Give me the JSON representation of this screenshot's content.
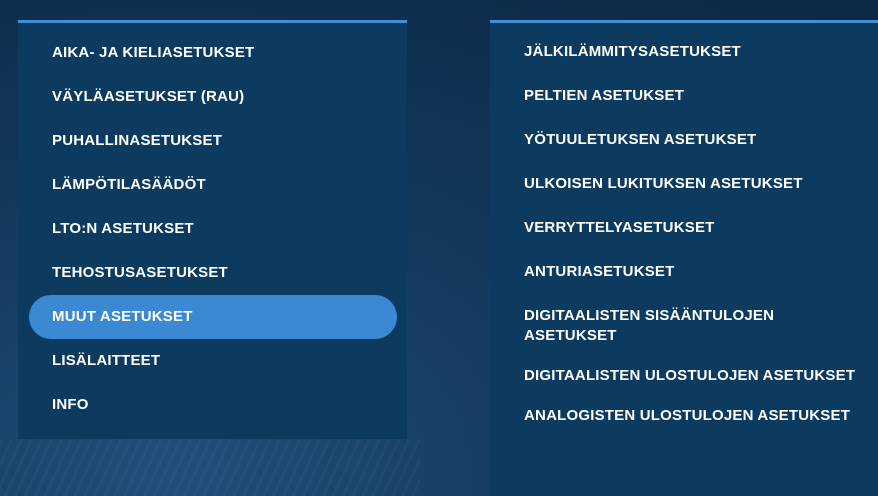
{
  "left_menu": {
    "items": [
      {
        "label": "AIKA- JA KIELIASETUKSET"
      },
      {
        "label": "VÄYLÄASETUKSET (RAU)"
      },
      {
        "label": "PUHALLINASETUKSET"
      },
      {
        "label": "LÄMPÖTILASÄÄDÖT"
      },
      {
        "label": "LTO:N ASETUKSET"
      },
      {
        "label": "TEHOSTUSASETUKSET"
      },
      {
        "label": "MUUT ASETUKSET"
      },
      {
        "label": "LISÄLAITTEET"
      },
      {
        "label": "INFO"
      }
    ]
  },
  "right_menu": {
    "items": [
      {
        "label": "JÄLKILÄMMITYSASETUKSET"
      },
      {
        "label": "PELTIEN ASETUKSET"
      },
      {
        "label": "YÖTUULETUKSEN ASETUKSET"
      },
      {
        "label": "ULKOISEN LUKITUKSEN ASETUKSET"
      },
      {
        "label": "VERRYTTELYASETUKSET"
      },
      {
        "label": "ANTURIASETUKSET"
      },
      {
        "label": "DIGITAALISTEN SISÄÄNTULOJEN ASETUKSET"
      },
      {
        "label": "DIGITAALISTEN ULOSTULOJEN ASETUKSET"
      },
      {
        "label": "ANALOGISTEN ULOSTULOJEN ASETUKSET"
      }
    ]
  },
  "colors": {
    "accent": "#3f90d8",
    "active_pill": "#3b88d3",
    "panel": "#0d3a5f",
    "text": "#ffffff"
  }
}
